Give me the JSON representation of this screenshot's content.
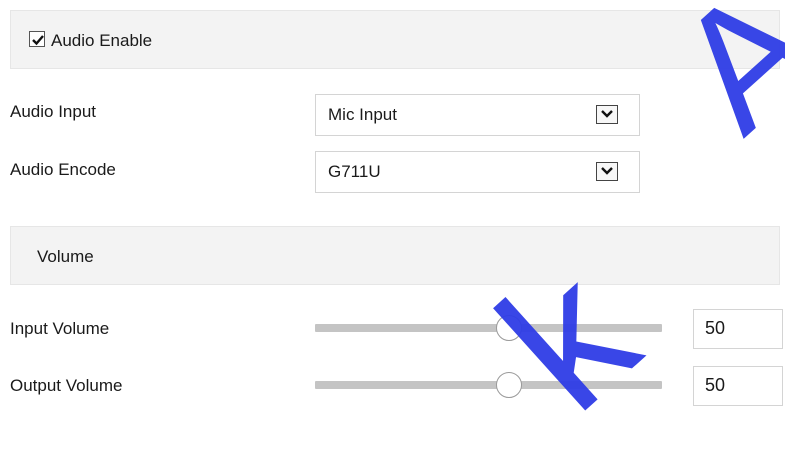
{
  "audio_enable": {
    "label": "Audio Enable",
    "checked": true
  },
  "audio_input": {
    "label": "Audio Input",
    "value": "Mic Input"
  },
  "audio_encode": {
    "label": "Audio Encode",
    "value": "G711U"
  },
  "volume_section": {
    "title": "Volume"
  },
  "input_volume": {
    "label": "Input Volume",
    "value": "50",
    "level": 0.5
  },
  "output_volume": {
    "label": "Output Volume",
    "value": "50",
    "level": 0.5
  },
  "watermark": {
    "text": "A",
    "text2": "k"
  },
  "colors": {
    "watermark": "#2f3de6",
    "track": "#c4c4c4",
    "header_bg": "#f3f3f3"
  }
}
